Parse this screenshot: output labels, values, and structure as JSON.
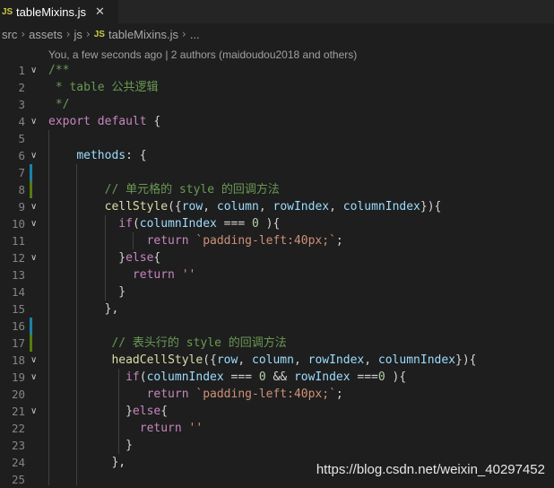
{
  "tab": {
    "badge": "JS",
    "title": "tableMixins.js",
    "close": "✕"
  },
  "breadcrumb": {
    "items": [
      "src",
      "assets",
      "js",
      "tableMixins.js",
      "..."
    ],
    "badge": "JS",
    "separator": "›"
  },
  "codelens": "You, a few seconds ago | 2 authors (maidoudou2018 and others)",
  "fold_icon": "chevron-down-icon",
  "lines": [
    {
      "n": "1",
      "fold": true,
      "tokens": [
        [
          "/**",
          "cmt"
        ]
      ]
    },
    {
      "n": "2",
      "tokens": [
        [
          " * table 公共逻辑",
          "cmt"
        ]
      ]
    },
    {
      "n": "3",
      "tokens": [
        [
          " */",
          "cmt"
        ]
      ]
    },
    {
      "n": "4",
      "fold": true,
      "tokens": [
        [
          "export",
          "ctrl"
        ],
        [
          " ",
          ""
        ],
        [
          "default",
          "ctrl"
        ],
        [
          " {",
          ""
        ]
      ]
    },
    {
      "n": "5",
      "tokens": []
    },
    {
      "n": "6",
      "fold": true,
      "tokens": [
        [
          "    ",
          ""
        ],
        [
          "methods",
          "prop"
        ],
        [
          ": {",
          ""
        ]
      ]
    },
    {
      "n": "7",
      "tokens": []
    },
    {
      "n": "8",
      "tokens": [
        [
          "        ",
          ""
        ],
        [
          "// 单元格的 style 的回调方法",
          "cmt"
        ]
      ]
    },
    {
      "n": "9",
      "fold": true,
      "tokens": [
        [
          "        ",
          ""
        ],
        [
          "cellStyle",
          "fn"
        ],
        [
          "({",
          ""
        ],
        [
          "row",
          "param"
        ],
        [
          ", ",
          ""
        ],
        [
          "column",
          "param"
        ],
        [
          ", ",
          ""
        ],
        [
          "rowIndex",
          "param"
        ],
        [
          ", ",
          ""
        ],
        [
          "columnIndex",
          "param"
        ],
        [
          "}){",
          ""
        ]
      ]
    },
    {
      "n": "10",
      "fold": true,
      "tokens": [
        [
          "          ",
          ""
        ],
        [
          "if",
          "ctrl"
        ],
        [
          "(",
          ""
        ],
        [
          "columnIndex",
          "param"
        ],
        [
          " === ",
          ""
        ],
        [
          "0",
          "num"
        ],
        [
          " ){",
          ""
        ]
      ]
    },
    {
      "n": "11",
      "tokens": [
        [
          "              ",
          ""
        ],
        [
          "return",
          "ctrl"
        ],
        [
          " ",
          ""
        ],
        [
          "`padding-left:40px;`",
          "str"
        ],
        [
          ";",
          ""
        ]
      ]
    },
    {
      "n": "12",
      "fold": true,
      "tokens": [
        [
          "          }",
          ""
        ],
        [
          "else",
          "ctrl"
        ],
        [
          "{",
          ""
        ]
      ]
    },
    {
      "n": "13",
      "tokens": [
        [
          "            ",
          ""
        ],
        [
          "return",
          "ctrl"
        ],
        [
          " ",
          ""
        ],
        [
          "''",
          "str"
        ]
      ]
    },
    {
      "n": "14",
      "tokens": [
        [
          "          }",
          ""
        ]
      ]
    },
    {
      "n": "15",
      "tokens": [
        [
          "        },",
          ""
        ]
      ]
    },
    {
      "n": "16",
      "tokens": []
    },
    {
      "n": "17",
      "tokens": [
        [
          "         ",
          ""
        ],
        [
          "// 表头行的 style 的回调方法",
          "cmt"
        ]
      ]
    },
    {
      "n": "18",
      "fold": true,
      "tokens": [
        [
          "         ",
          ""
        ],
        [
          "headCellStyle",
          "fn"
        ],
        [
          "({",
          ""
        ],
        [
          "row",
          "param"
        ],
        [
          ", ",
          ""
        ],
        [
          "column",
          "param"
        ],
        [
          ", ",
          ""
        ],
        [
          "rowIndex",
          "param"
        ],
        [
          ", ",
          ""
        ],
        [
          "columnIndex",
          "param"
        ],
        [
          "}){",
          ""
        ]
      ]
    },
    {
      "n": "19",
      "fold": true,
      "tokens": [
        [
          "           ",
          ""
        ],
        [
          "if",
          "ctrl"
        ],
        [
          "(",
          ""
        ],
        [
          "columnIndex",
          "param"
        ],
        [
          " === ",
          ""
        ],
        [
          "0",
          "num"
        ],
        [
          " && ",
          ""
        ],
        [
          "rowIndex",
          "param"
        ],
        [
          " ===",
          ""
        ],
        [
          "0",
          "num"
        ],
        [
          " ){",
          ""
        ]
      ]
    },
    {
      "n": "20",
      "tokens": [
        [
          "              ",
          ""
        ],
        [
          "return",
          "ctrl"
        ],
        [
          " ",
          ""
        ],
        [
          "`padding-left:40px;`",
          "str"
        ],
        [
          ";",
          ""
        ]
      ]
    },
    {
      "n": "21",
      "fold": true,
      "tokens": [
        [
          "           }",
          ""
        ],
        [
          "else",
          "ctrl"
        ],
        [
          "{",
          ""
        ]
      ]
    },
    {
      "n": "22",
      "tokens": [
        [
          "             ",
          ""
        ],
        [
          "return",
          "ctrl"
        ],
        [
          " ",
          ""
        ],
        [
          "''",
          "str"
        ]
      ]
    },
    {
      "n": "23",
      "tokens": [
        [
          "           }",
          ""
        ]
      ]
    },
    {
      "n": "24",
      "tokens": [
        [
          "         },",
          ""
        ]
      ]
    },
    {
      "n": "25",
      "tokens": []
    }
  ],
  "colors": {
    "background": "#1e1e1e",
    "git_modified": "#1b81a8",
    "git_added": "#587c0c"
  },
  "watermark": "https://blog.csdn.net/weixin_40297452"
}
